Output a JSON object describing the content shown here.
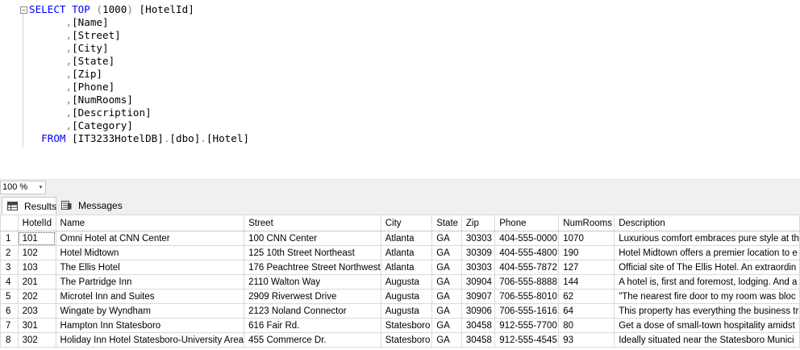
{
  "editor": {
    "lines": [
      [
        {
          "t": "SELECT",
          "c": "kw"
        },
        {
          "t": " TOP ",
          "c": "kw"
        },
        {
          "t": "(",
          "c": "gray"
        },
        {
          "t": "1000",
          "c": ""
        },
        {
          "t": ")",
          "c": "gray"
        },
        {
          "t": " [HotelId]",
          "c": ""
        }
      ],
      [
        {
          "t": "      ",
          "c": ""
        },
        {
          "t": ",",
          "c": "gray"
        },
        {
          "t": "[Name]",
          "c": ""
        }
      ],
      [
        {
          "t": "      ",
          "c": ""
        },
        {
          "t": ",",
          "c": "gray"
        },
        {
          "t": "[Street]",
          "c": ""
        }
      ],
      [
        {
          "t": "      ",
          "c": ""
        },
        {
          "t": ",",
          "c": "gray"
        },
        {
          "t": "[City]",
          "c": ""
        }
      ],
      [
        {
          "t": "      ",
          "c": ""
        },
        {
          "t": ",",
          "c": "gray"
        },
        {
          "t": "[State]",
          "c": ""
        }
      ],
      [
        {
          "t": "      ",
          "c": ""
        },
        {
          "t": ",",
          "c": "gray"
        },
        {
          "t": "[Zip]",
          "c": ""
        }
      ],
      [
        {
          "t": "      ",
          "c": ""
        },
        {
          "t": ",",
          "c": "gray"
        },
        {
          "t": "[Phone]",
          "c": ""
        }
      ],
      [
        {
          "t": "      ",
          "c": ""
        },
        {
          "t": ",",
          "c": "gray"
        },
        {
          "t": "[NumRooms]",
          "c": ""
        }
      ],
      [
        {
          "t": "      ",
          "c": ""
        },
        {
          "t": ",",
          "c": "gray"
        },
        {
          "t": "[Description]",
          "c": ""
        }
      ],
      [
        {
          "t": "      ",
          "c": ""
        },
        {
          "t": ",",
          "c": "gray"
        },
        {
          "t": "[Category]",
          "c": ""
        }
      ],
      [
        {
          "t": "  FROM",
          "c": "kw"
        },
        {
          "t": " [IT3233HotelDB]",
          "c": ""
        },
        {
          "t": ".",
          "c": "gray"
        },
        {
          "t": "[dbo]",
          "c": ""
        },
        {
          "t": ".",
          "c": "gray"
        },
        {
          "t": "[Hotel]",
          "c": ""
        }
      ]
    ],
    "fold_glyph": "−"
  },
  "zoom": {
    "value": "100 %",
    "arrow": "▾"
  },
  "tabs": [
    {
      "label": "Results",
      "icon": "grid-icon",
      "active": true
    },
    {
      "label": "Messages",
      "icon": "messages-icon",
      "active": false
    }
  ],
  "grid": {
    "columns": [
      "",
      "HotelId",
      "Name",
      "Street",
      "City",
      "State",
      "Zip",
      "Phone",
      "NumRooms",
      "Description"
    ],
    "rows": [
      [
        "1",
        "101",
        "Omni Hotel at CNN Center",
        "100 CNN Center",
        "Atlanta",
        "GA",
        "30303",
        "404-555-0000",
        "1070",
        "Luxurious comfort embraces pure style at th"
      ],
      [
        "2",
        "102",
        "Hotel Midtown",
        "125 10th Street Northeast",
        "Atlanta",
        "GA",
        "30309",
        "404-555-4800",
        "190",
        "Hotel Midtown offers a premier location to e"
      ],
      [
        "3",
        "103",
        "The Ellis Hotel",
        "176 Peachtree Street Northwest",
        "Atlanta",
        "GA",
        "30303",
        "404-555-7872",
        "127",
        "Official site of The Ellis Hotel. An extraordin"
      ],
      [
        "4",
        "201",
        "The Partridge Inn",
        "2110 Walton Way",
        "Augusta",
        "GA",
        "30904",
        "706-555-8888",
        "144",
        "A hotel is, first and foremost, lodging. And a"
      ],
      [
        "5",
        "202",
        "Microtel Inn and Suites",
        "2909 Riverwest Drive",
        "Augusta",
        "GA",
        "30907",
        "706-555-8010",
        "62",
        "\"The nearest fire door to my room was bloc"
      ],
      [
        "6",
        "203",
        "Wingate by Wyndham",
        "2123 Noland Connector",
        "Augusta",
        "GA",
        "30906",
        "706-555-1616",
        "64",
        "This property has everything the business tr"
      ],
      [
        "7",
        "301",
        "Hampton Inn Statesboro",
        "616 Fair Rd.",
        "Statesboro",
        "GA",
        "30458",
        "912-555-7700",
        "80",
        "Get a dose of small-town hospitality amidst"
      ],
      [
        "8",
        "302",
        "Holiday Inn Hotel Statesboro-University Area",
        "455 Commerce Dr.",
        "Statesboro",
        "GA",
        "30458",
        "912-555-4545",
        "93",
        "Ideally situated near the Statesboro Munici"
      ]
    ]
  }
}
